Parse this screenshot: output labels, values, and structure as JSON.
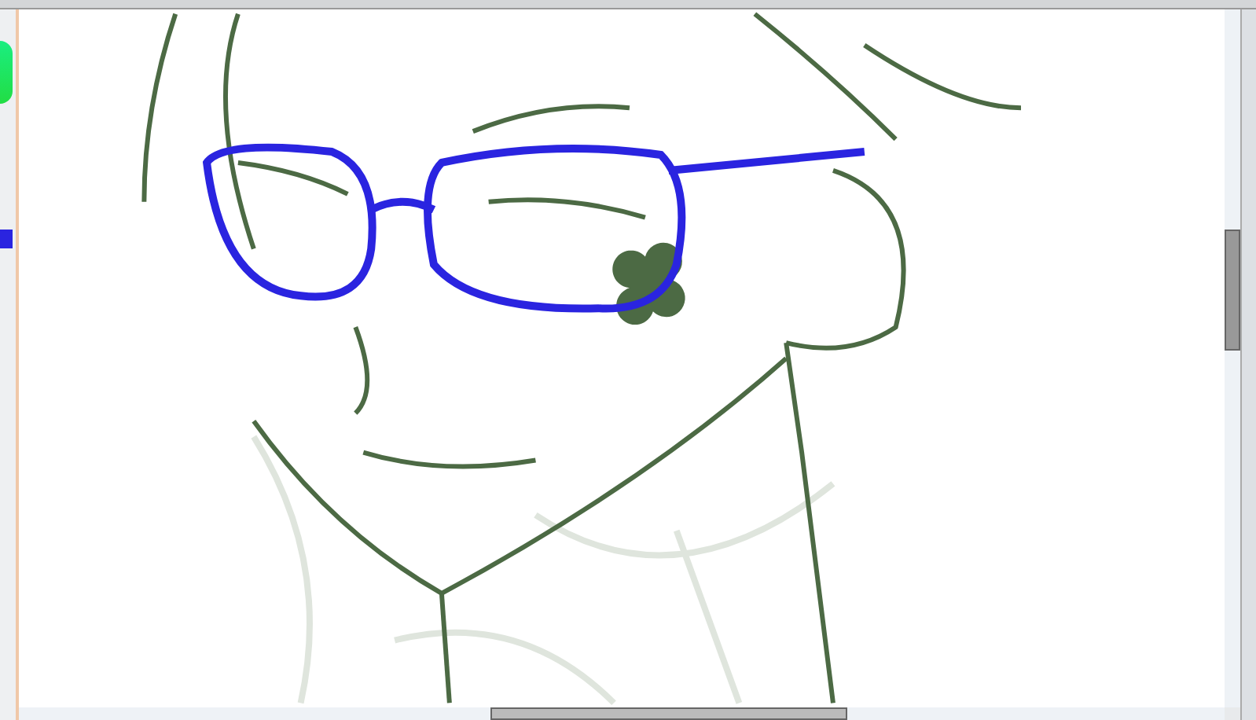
{
  "color_panel": {
    "current_color": {
      "color": "#2a24e0"
    }
  },
  "canvas": {
    "kind": "line-art"
  }
}
